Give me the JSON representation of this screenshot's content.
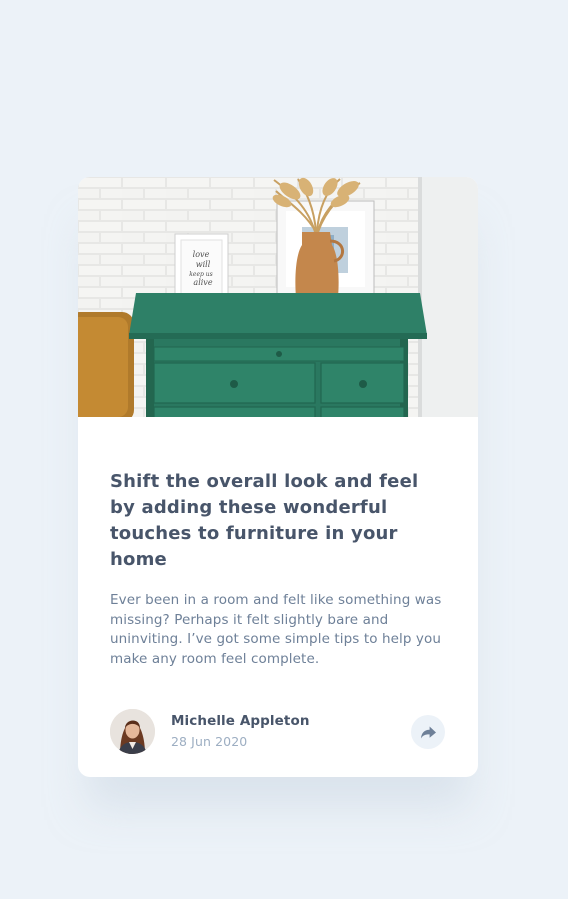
{
  "article": {
    "title": "Shift the overall look and feel by adding these wonderful touches to furniture in your home",
    "excerpt": "Ever been in a room and felt like something was missing? Perhaps it felt slightly bare and uninviting. I’ve got some simple tips to help you make any room feel complete.",
    "image": {
      "name": "drawers-photo",
      "frame_text": [
        "love",
        "will",
        "keep us",
        "alive"
      ]
    }
  },
  "author": {
    "name": "Michelle Appleton",
    "date": "28 Jun 2020",
    "avatar_icon": "avatar-michelle"
  },
  "share": {
    "icon": "share-arrow-icon"
  },
  "colors": {
    "background": "#ECF2F8",
    "card": "#FFFFFF",
    "heading": "#48556A",
    "body_text": "#6E8098",
    "muted": "#9DAEC2",
    "share_bg": "#ECF2F8",
    "dresser": "#2C7C63"
  }
}
